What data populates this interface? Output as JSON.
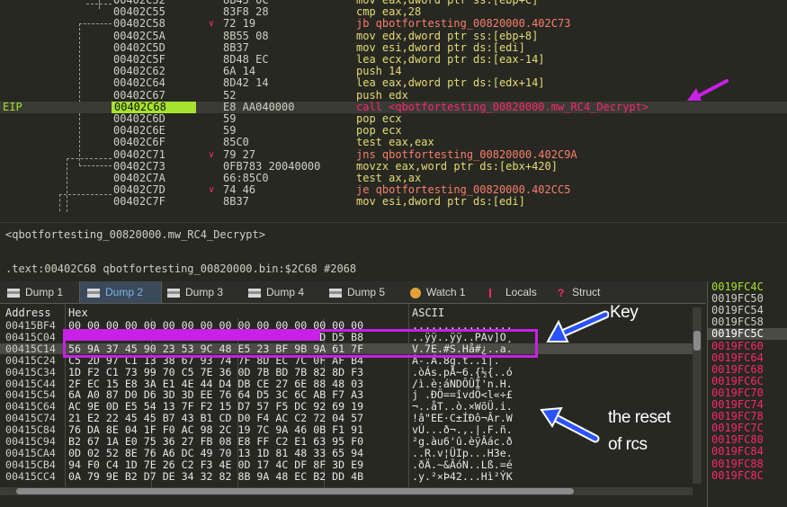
{
  "disasm": {
    "rows": [
      {
        "eip": "",
        "addr": "00402C52",
        "bytes": "8B45 0C",
        "ins": "mov eax,dword ptr ss:[ebp+C]",
        "kind": "plain"
      },
      {
        "eip": "",
        "addr": "00402C55",
        "bytes": "83F8 28",
        "ins": "cmp eax,28",
        "kind": "plain"
      },
      {
        "eip": "",
        "addr": "00402C58",
        "bytes": "72 19",
        "ins": "jb qbotfortesting_00820000.402C73",
        "kind": "jump"
      },
      {
        "eip": "",
        "addr": "00402C5A",
        "bytes": "8B55 08",
        "ins": "mov edx,dword ptr ss:[ebp+8]",
        "kind": "plain"
      },
      {
        "eip": "",
        "addr": "00402C5D",
        "bytes": "8B37",
        "ins": "mov esi,dword ptr ds:[edi]",
        "kind": "plain"
      },
      {
        "eip": "",
        "addr": "00402C5F",
        "bytes": "8D48 EC",
        "ins": "lea ecx,dword ptr ds:[eax-14]",
        "kind": "plain"
      },
      {
        "eip": "",
        "addr": "00402C62",
        "bytes": "6A 14",
        "ins": "push 14",
        "kind": "plain"
      },
      {
        "eip": "",
        "addr": "00402C64",
        "bytes": "8D42 14",
        "ins": "lea eax,dword ptr ds:[edx+14]",
        "kind": "plain"
      },
      {
        "eip": "",
        "addr": "00402C67",
        "bytes": "52",
        "ins": "push edx",
        "kind": "plain"
      },
      {
        "eip": "EIP",
        "addr": "00402C68",
        "bytes": "E8 AA040000",
        "ins": "call <qbotfortesting_00820000.mw_RC4_Decrypt>",
        "kind": "call",
        "current": true
      },
      {
        "eip": "",
        "addr": "00402C6D",
        "bytes": "59",
        "ins": "pop ecx",
        "kind": "plain"
      },
      {
        "eip": "",
        "addr": "00402C6E",
        "bytes": "59",
        "ins": "pop ecx",
        "kind": "plain"
      },
      {
        "eip": "",
        "addr": "00402C6F",
        "bytes": "85C0",
        "ins": "test eax,eax",
        "kind": "plain"
      },
      {
        "eip": "",
        "addr": "00402C71",
        "bytes": "79 27",
        "ins": "jns qbotfortesting_00820000.402C9A",
        "kind": "jump"
      },
      {
        "eip": "",
        "addr": "00402C73",
        "bytes": "0FB783 20040000",
        "ins": "movzx eax,word ptr ds:[ebx+420]",
        "kind": "plain"
      },
      {
        "eip": "",
        "addr": "00402C7A",
        "bytes": "66:85C0",
        "ins": "test ax,ax",
        "kind": "plain"
      },
      {
        "eip": "",
        "addr": "00402C7D",
        "bytes": "74 46",
        "ins": "je qbotfortesting_00820000.402CC5",
        "kind": "jump"
      },
      {
        "eip": "",
        "addr": "00402C7F",
        "bytes": "8B37",
        "ins": "mov esi,dword ptr ds:[edi]",
        "kind": "plain"
      }
    ]
  },
  "info": {
    "line1": "<qbotfortesting_00820000.mw_RC4_Decrypt>",
    "line2": ".text:00402C68 qbotfortesting_00820000.bin:$2C68 #2068"
  },
  "tabs": [
    {
      "label": "Dump 1",
      "active": false,
      "icon": "dump-icon"
    },
    {
      "label": "Dump 2",
      "active": true,
      "icon": "dump-icon"
    },
    {
      "label": "Dump 3",
      "active": false,
      "icon": "dump-icon"
    },
    {
      "label": "Dump 4",
      "active": false,
      "icon": "dump-icon"
    },
    {
      "label": "Dump 5",
      "active": false,
      "icon": "dump-icon"
    },
    {
      "label": "Watch 1",
      "active": false,
      "icon": "watch-icon"
    },
    {
      "label": "Locals",
      "active": false,
      "icon": "locals-icon"
    },
    {
      "label": "Struct",
      "active": false,
      "icon": "struct-icon"
    }
  ],
  "dump": {
    "headers": {
      "address": "Address",
      "hex": "Hex",
      "ascii": "ASCII"
    },
    "rows": [
      {
        "a": "00415BF4",
        "h": "00 00 00 00 00 00 00 00 00 00 00 00 00 00 00 00",
        "s": "................"
      },
      {
        "a": "00415C04",
        "h": "                                    76 5D D5 B8",
        "s": "..ÿÿ..ÿÿ..PAv]Õ¸"
      },
      {
        "a": "00415C14",
        "h": "56 9A 37 45 90 23 53 9C 48 E5 23 BF 9B 9A 61 7F",
        "s": "V.7E.#S.Hå#¿..a.",
        "sel": true
      },
      {
        "a": "00415C24",
        "h": "C5 2D 97 C1 13 38 67 93 74 7F 8D EC 7C 0F AF B4",
        "s": "Å-.Á.8g.t..ì|.¯´"
      },
      {
        "a": "00415C34",
        "h": "1D F2 C1 73 99 70 C5 7E 36 0D 7B BD 7B 82 8D F3",
        "s": ".òÁs.pÅ~6.{½{..ó"
      },
      {
        "a": "00415C44",
        "h": "2F EC 15 E8 3A E1 4E 44 D4 DB CE 27 6E 88 48 03",
        "s": "/ì.è:áNDÔÛÎ'n.H."
      },
      {
        "a": "00415C54",
        "h": "6A A0 87 D0 D6 3D 3D EE 76 64 D5 3C 6C AB F7 A3",
        "s": "j .ÐÖ==îvdÕ<l«÷£"
      },
      {
        "a": "00415C64",
        "h": "AC 9E 0D E5 54 13 7F F2 15 D7 57 F5 DC 92 69 19",
        "s": "¬..åT..ò.×WõÜ.i."
      },
      {
        "a": "00415C74",
        "h": "21 E2 22 45 45 B7 43 B1 CD D0 F4 AC C2 72 04 57",
        "s": "!â\"EE·C±ÍÐô¬Âr.W"
      },
      {
        "a": "00415C84",
        "h": "76 DA 8E 04 1F F0 AC 98 2C 19 7C 9A 46 0B F1 91",
        "s": "vÚ...ð¬.,.|.F.ñ."
      },
      {
        "a": "00415C94",
        "h": "B2 67 1A E0 75 36 27 FB 08 E8 FF C2 E1 63 95 F0",
        "s": "²g.àu6'û.èÿÂác.ð"
      },
      {
        "a": "00415CA4",
        "h": "0D 02 52 8E 76 A6 DC 49 70 13 1D 81 48 33 65 94",
        "s": "..R.v¦ÜIp...H3e."
      },
      {
        "a": "00415CB4",
        "h": "94 F0 C4 1D 7E 26 C2 F3 4E 0D 17 4C DF 8F 3D E9",
        "s": ".ðÄ.~&ÂóN..Lß.=é"
      },
      {
        "a": "00415CC4",
        "h": "0A 79 9E B2 D7 DE 34 32 82 8B 9A 48 EC B2 DD 4B",
        "s": ".y.²×Þ42...Hì²ÝK"
      }
    ]
  },
  "stack": {
    "rows": [
      {
        "a": "0019FC4C",
        "color": "#a6e22e"
      },
      {
        "a": "0019FC50",
        "color": "#cfcfc2"
      },
      {
        "a": "0019FC54",
        "color": "#cfcfc2"
      },
      {
        "a": "0019FC58",
        "color": "#cfcfc2"
      },
      {
        "a": "0019FC5C",
        "color": "#ffffff",
        "sel": true
      },
      {
        "a": "0019FC60",
        "color": "#f92672"
      },
      {
        "a": "0019FC64",
        "color": "#f92672"
      },
      {
        "a": "0019FC68",
        "color": "#f92672"
      },
      {
        "a": "0019FC6C",
        "color": "#f92672"
      },
      {
        "a": "0019FC70",
        "color": "#f92672"
      },
      {
        "a": "0019FC74",
        "color": "#f92672"
      },
      {
        "a": "0019FC78",
        "color": "#f92672"
      },
      {
        "a": "0019FC7C",
        "color": "#f92672"
      },
      {
        "a": "0019FC80",
        "color": "#f92672"
      },
      {
        "a": "0019FC84",
        "color": "#f92672"
      },
      {
        "a": "0019FC88",
        "color": "#f92672"
      },
      {
        "a": "0019FC8C",
        "color": "#f92672"
      }
    ]
  },
  "annotations": {
    "key_label": "Key",
    "rest_label_1": "the reset",
    "rest_label_2": "of rcs",
    "color": "#c820e6"
  }
}
